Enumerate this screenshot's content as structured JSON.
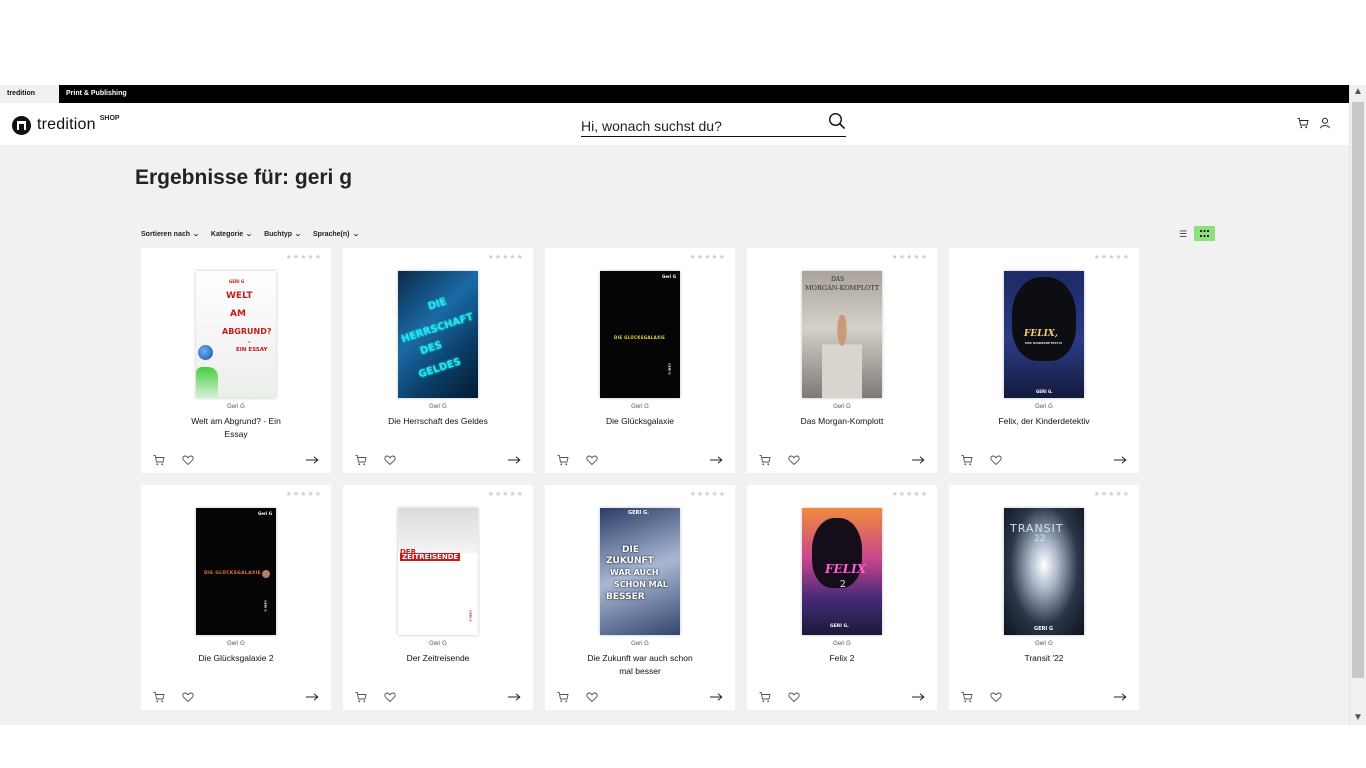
{
  "tabs": [
    {
      "label": "tredition Shop",
      "active": true
    },
    {
      "label": "Print & Publishing",
      "active": false
    }
  ],
  "header": {
    "logo_text": "tredition",
    "logo_sup": "SHOP",
    "search_placeholder": "Hi, wonach suchst du?",
    "icons": [
      "cart-icon",
      "user-icon"
    ]
  },
  "page": {
    "title": "Ergebnisse für: geri g"
  },
  "filters": [
    {
      "label": "Sortieren nach"
    },
    {
      "label": "Kategorie"
    },
    {
      "label": "Buchtyp"
    },
    {
      "label": "Sprache(n)"
    }
  ],
  "view_toggle": {
    "list_icon": "list-view-icon",
    "grid_icon": "grid-view-icon",
    "active": "grid"
  },
  "colors": {
    "accent_green": "#8ee07f",
    "background": "#f1f1f1",
    "tabbar": "#000000"
  },
  "products": [
    {
      "author": "Geri G",
      "title": "Welt am Abgrund? - Ein Essay",
      "rating": 0,
      "cover_lines": [
        "GERI G",
        "WELT",
        "AM",
        "ABGRUND?",
        "-",
        "EIN ESSAY"
      ]
    },
    {
      "author": "Geri G",
      "title": "Die Herrschaft des Geldes",
      "rating": 0,
      "cover_lines": [
        "DIE",
        "HERRSCHAFT",
        "DES",
        "GELDES"
      ]
    },
    {
      "author": "Geri G",
      "title": "Die Glücksgalaxie",
      "rating": 0,
      "cover_lines": [
        "Geri G",
        "DIE GLÜCKSGALAXIE"
      ]
    },
    {
      "author": "Geri G",
      "title": "Das Morgan-Komplott",
      "rating": 0,
      "cover_lines": [
        "DAS",
        "MORGAN-KOMPLOTT"
      ]
    },
    {
      "author": "Geri G",
      "title": "Felix, der Kinderdetektiv",
      "rating": 0,
      "cover_lines": [
        "FELIX,",
        "DER KINDERDETEKTIV",
        "GERI G."
      ]
    },
    {
      "author": "Geri G",
      "title": "Die Glücksgalaxie 2",
      "rating": 0,
      "cover_lines": [
        "Geri G",
        "DIE GLÜCKSGALAXIE"
      ]
    },
    {
      "author": "Geri G",
      "title": "Der Zeitreisende",
      "rating": 0,
      "cover_lines": [
        "DER",
        "ZEITREISENDE"
      ]
    },
    {
      "author": "Geri G",
      "title": "Die Zukunft war auch schon mal besser",
      "rating": 0,
      "cover_lines": [
        "GERI G.",
        "DIE",
        "ZUKUNFT",
        "WAR AUCH",
        "SCHON MAL",
        "BESSER"
      ]
    },
    {
      "author": "Geri G",
      "title": "Felix 2",
      "rating": 0,
      "cover_lines": [
        "FELIX",
        "2",
        "GERI G."
      ]
    },
    {
      "author": "Geri G",
      "title": "Transit '22",
      "rating": 0,
      "cover_lines": [
        "TRANSIT",
        "22",
        "GERI G"
      ]
    }
  ],
  "stars_glyph": "★★★★★"
}
